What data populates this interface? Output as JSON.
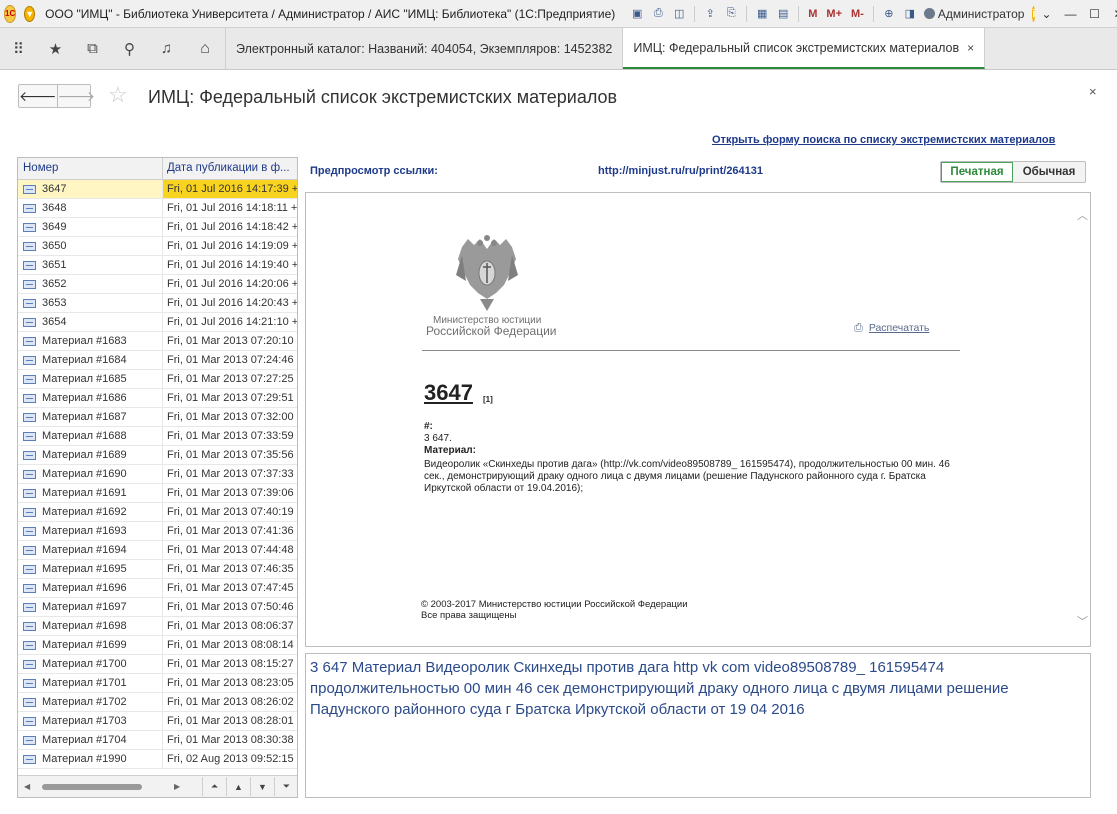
{
  "window": {
    "logo_text": "1C",
    "title": "ООО \"ИМЦ\" - Библиотека Университета / Администратор / АИС \"ИМЦ: Библиотека\"  (1С:Предприятие)",
    "toolbar_icons": [
      "save-icon",
      "print-icon",
      "preview-icon",
      "upload-icon",
      "printer-icon",
      "calculator-icon",
      "calendar-icon"
    ],
    "memory_buttons": [
      "M",
      "M+",
      "M-"
    ],
    "user": "Администратор",
    "info_label": "i"
  },
  "tabs": [
    {
      "label": "Электронный каталог: Названий: 404054, Экземпляров: 1452382",
      "close": "×"
    },
    {
      "label": "ИМЦ: Федеральный список экстремистских материалов",
      "close": "×"
    }
  ],
  "page": {
    "title": "ИМЦ: Федеральный список экстремистских материалов",
    "close": "×",
    "search_link": "Открыть форму поиска по списку экстремистских материалов"
  },
  "list": {
    "col_number": "Номер",
    "col_date": "Дата публикации в ф...",
    "rows": [
      {
        "num": "3647",
        "date": "Fri, 01 Jul 2016 14:17:39 +0"
      },
      {
        "num": "3648",
        "date": "Fri, 01 Jul 2016 14:18:11 +0"
      },
      {
        "num": "3649",
        "date": "Fri, 01 Jul 2016 14:18:42 +0"
      },
      {
        "num": "3650",
        "date": "Fri, 01 Jul 2016 14:19:09 +0"
      },
      {
        "num": "3651",
        "date": "Fri, 01 Jul 2016 14:19:40 +0"
      },
      {
        "num": "3652",
        "date": "Fri, 01 Jul 2016 14:20:06 +0"
      },
      {
        "num": "3653",
        "date": "Fri, 01 Jul 2016 14:20:43 +0"
      },
      {
        "num": "3654",
        "date": "Fri, 01 Jul 2016 14:21:10 +0"
      },
      {
        "num": "Материал #1683",
        "date": "Fri, 01 Mar 2013 07:20:10 +"
      },
      {
        "num": "Материал #1684",
        "date": "Fri, 01 Mar 2013 07:24:46 +"
      },
      {
        "num": "Материал #1685",
        "date": "Fri, 01 Mar 2013 07:27:25 +"
      },
      {
        "num": "Материал #1686",
        "date": "Fri, 01 Mar 2013 07:29:51 +"
      },
      {
        "num": "Материал #1687",
        "date": "Fri, 01 Mar 2013 07:32:00 +"
      },
      {
        "num": "Материал #1688",
        "date": "Fri, 01 Mar 2013 07:33:59 +"
      },
      {
        "num": "Материал #1689",
        "date": "Fri, 01 Mar 2013 07:35:56 +"
      },
      {
        "num": "Материал #1690",
        "date": "Fri, 01 Mar 2013 07:37:33 +"
      },
      {
        "num": "Материал #1691",
        "date": "Fri, 01 Mar 2013 07:39:06 +"
      },
      {
        "num": "Материал #1692",
        "date": "Fri, 01 Mar 2013 07:40:19 +"
      },
      {
        "num": "Материал #1693",
        "date": "Fri, 01 Mar 2013 07:41:36 +"
      },
      {
        "num": "Материал #1694",
        "date": "Fri, 01 Mar 2013 07:44:48 +"
      },
      {
        "num": "Материал #1695",
        "date": "Fri, 01 Mar 2013 07:46:35 +"
      },
      {
        "num": "Материал #1696",
        "date": "Fri, 01 Mar 2013 07:47:45 +"
      },
      {
        "num": "Материал #1697",
        "date": "Fri, 01 Mar 2013 07:50:46 +"
      },
      {
        "num": "Материал #1698",
        "date": "Fri, 01 Mar 2013 08:06:37 +"
      },
      {
        "num": "Материал #1699",
        "date": "Fri, 01 Mar 2013 08:08:14 +"
      },
      {
        "num": "Материал #1700",
        "date": "Fri, 01 Mar 2013 08:15:27 +"
      },
      {
        "num": "Материал #1701",
        "date": "Fri, 01 Mar 2013 08:23:05 +"
      },
      {
        "num": "Материал #1702",
        "date": "Fri, 01 Mar 2013 08:26:02 +"
      },
      {
        "num": "Материал #1703",
        "date": "Fri, 01 Mar 2013 08:28:01 +"
      },
      {
        "num": "Материал #1704",
        "date": "Fri, 01 Mar 2013 08:30:38 +"
      },
      {
        "num": "Материал #1990",
        "date": "Fri, 02 Aug 2013 09:52:15 +"
      }
    ],
    "selected_index": 0
  },
  "preview": {
    "label": "Предпросмотр ссылки:",
    "url": "http://minjust.ru/ru/print/264131",
    "toggle_print": "Печатная",
    "toggle_normal": "Обычная",
    "ministry_line1": "Министерство юстиции",
    "ministry_line2": "Российской Федерации",
    "print_link": "Распечатать",
    "doc_number": "3647",
    "doc_ref": "[1]",
    "field_hash_label": "#:",
    "field_hash_value": "3 647.",
    "field_material_label": "Материал:",
    "field_material_value": "Видеоролик «Скинхеды против дага» (http://vk.com/video89508789_ 161595474), продолжительностью 00 мин. 46 сек., демонстрирующий драку одного лица с двумя лицами (решение Падунского районного суда г. Братска Иркутской области от 19.04.2016);",
    "copyright_1": "© 2003-2017 Министерство юстиции Российской Федерации",
    "copyright_2": "Все права защищены"
  },
  "text_output": "3 647 Материал Видеоролик Скинхеды против дага http vk com video89508789_ 161595474 продолжительностью 00 мин 46 сек демонстрирующий драку одного лица с двумя лицами решение Падунского районного суда г Братска Иркутской области от 19 04 2016",
  "colors": {
    "accent_green": "#2c8a3a",
    "link_blue": "#1e3a8a",
    "selection_yellow": "#f8d320"
  }
}
